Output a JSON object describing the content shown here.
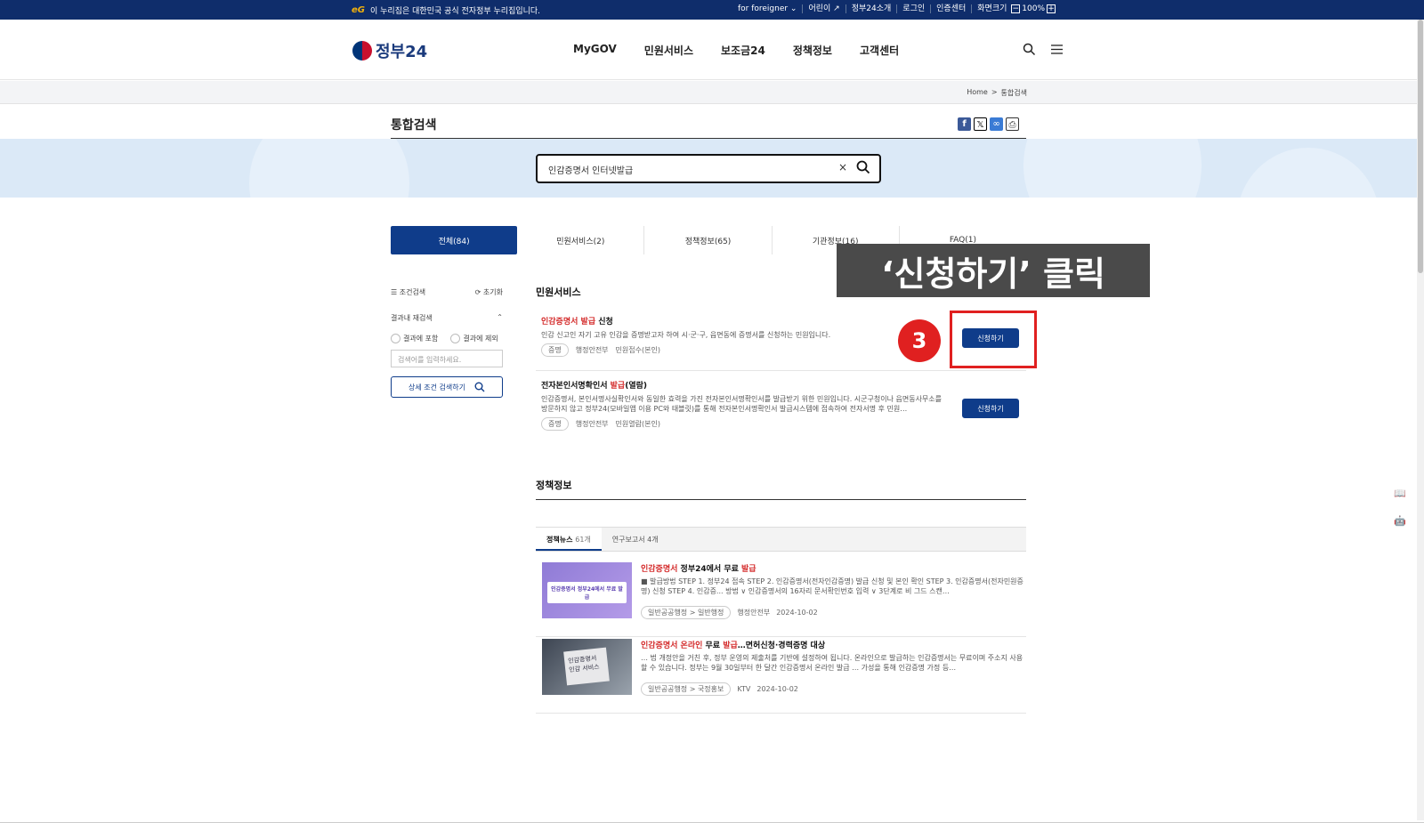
{
  "topbar": {
    "eg_logo": "eG",
    "notice": "이 누리집은 대한민국 공식 전자정부 누리집입니다.",
    "links": [
      "for foreigner ⌄",
      "어린이 ↗",
      "정부24소개",
      "로그인",
      "인증센터"
    ],
    "zoom_label": "화면크기",
    "zoom_minus": "−",
    "zoom_value": "100%",
    "zoom_plus": "+"
  },
  "header": {
    "logo_text": "정부24",
    "nav": [
      "MyGOV",
      "민원서비스",
      "보조금24",
      "정책정보",
      "고객센터"
    ],
    "search_icon": "search-icon",
    "menu_icon": "hamburger-icon"
  },
  "breadcrumb": {
    "home": "Home",
    "separator": ">",
    "current": "통합검색"
  },
  "page": {
    "title": "통합검색"
  },
  "search": {
    "value": "인감증명서 인터넷발급",
    "clear": "×",
    "icon": "search-icon"
  },
  "tabs": [
    "전체(84)",
    "민원서비스(2)",
    "정책정보(65)",
    "기관정보(16)",
    "FAQ(1)"
  ],
  "sidebar": {
    "condition_label": "조건검색",
    "reset_label": "초기화",
    "refine_label": "결과내 재검색",
    "include_label": "결과에 포함",
    "exclude_label": "결과에 제외",
    "input_placeholder": "검색어를 입력하세요.",
    "button_label": "상세 조건 검색하기"
  },
  "sections": {
    "services": "민원서비스",
    "policy": "정책정보"
  },
  "services": [
    {
      "name_hl": "인감증명서 발급",
      "name_rest": " 신청",
      "desc": "인감 신고인 자기 고유 인감을 증명받고자 하여 시·군·구, 읍면동에 증명서를 신청하는 민원입니다.",
      "tag": "증명",
      "agency": "행정안전부",
      "receipt": "민원접수(본인)",
      "button": "신청하기"
    },
    {
      "name_pre": "전자본인서명확인서 ",
      "name_hl": "발급",
      "name_rest": "(열람)",
      "desc": "인감증명서, 본인서명사실확인서와 동일한 효력을 가진 전자본인서명확인서를 발급받기 위한 민원입니다. 시군구청이나 읍면동사무소를 방문하지 않고 정부24(모바일앱 이용 PC와 태블릿)를 통해 전자본인서명확인서 발급시스템에 접속하여 전자서명 후 민원…",
      "tag": "증명",
      "agency": "행정안전부",
      "receipt": "민원열람(본인)",
      "button": "신청하기"
    }
  ],
  "annotation": {
    "step": "3",
    "callout": "‘신청하기’ 클릭"
  },
  "policy": {
    "subtabs": [
      {
        "label": "정책뉴스",
        "count": "61개"
      },
      {
        "label": "연구보고서",
        "count": "4개"
      }
    ],
    "news": [
      {
        "title_hl1": "인감증명서",
        "title_mid": " 정부24에서 무료 ",
        "title_hl2": "발급",
        "body": "■ 발급방법 STEP 1. 정부24 접속 STEP 2. 인감증명서(전자인감증명) 발급 신청 및 본인 확인 STEP 3. 인감증명서(전자민원증명) 신청 STEP 4. 인감증... 방법 ∨ 인감증명서의 16자리 문서확인번호 입력 ∨ 3단계로 비 그드 스캔…",
        "category": "일반공공행정 > 일반행정",
        "source": "행정안전부",
        "date": "2024-10-02",
        "thumb_text": "인감증명서 정부24에서 무료 발급"
      },
      {
        "title_hl1": "인감증명서 온라인",
        "title_mid": " 무료 ",
        "title_hl2": "발급",
        "title_tail": "…면허신청·경력증명 대상",
        "body": "… 법 개정안을 거친 후, 정부 운영의 제출처를 기반에 설정하여 됩니다. 온라인으로 발급하는 인감증명서는 무료이며 주소지 사용할 수 있습니다. 정부는 9월 30일부터 한 달간 인감증명서 온라인 발급 … 가성을 통해 인감증명 가정 등…",
        "category": "일반공공행정 > 국정홍보",
        "source": "KTV",
        "date": "2024-10-02",
        "thumb_text": "인감증명서 인감 서비스"
      }
    ]
  },
  "colors": {
    "navy": "#0f2d6b",
    "primary": "#0f3c8a",
    "highlight": "#d42b2b",
    "annotation": "#e02020",
    "band": "#dbe9f7"
  }
}
